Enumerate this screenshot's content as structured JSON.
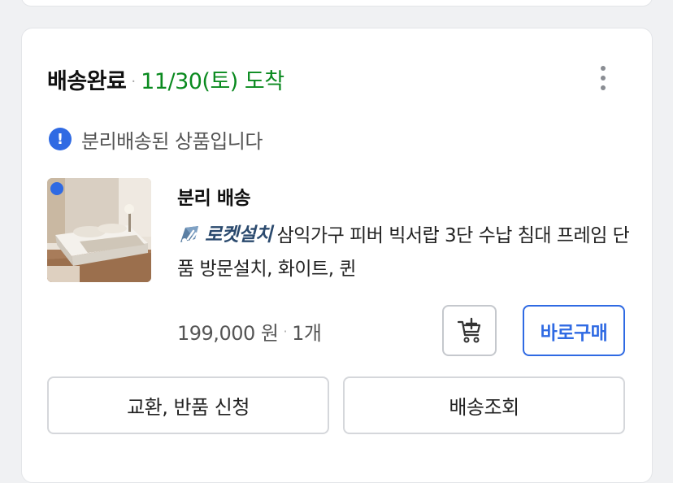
{
  "order": {
    "status": "배송완료",
    "separator": "·",
    "arrival": "11/30(토) 도착",
    "more_icon": "more-vertical-icon"
  },
  "notice": {
    "icon": "info-exclamation-icon",
    "icon_glyph": "!",
    "text": "분리배송된 상품입니다"
  },
  "item": {
    "shipping_label": "분리 배송",
    "badge": "로켓설치",
    "badge_icon": "rocket-icon",
    "name": "삼익가구 피버 빅서랍 3단 수납 침대 프레임 단품 방문설치, 화이트, 퀸",
    "price": "199,000 원",
    "price_separator": "·",
    "quantity": "1개",
    "image": "bed-product-thumbnail",
    "unread": true
  },
  "actions": {
    "cart_icon": "add-to-cart-icon",
    "buy_now": "바로구매",
    "exchange_return": "교환, 반품 신청",
    "track_delivery": "배송조회"
  },
  "colors": {
    "accent_blue": "#2f6ae3",
    "arrival_green": "#0a8a1f",
    "border": "#d5d7db"
  }
}
